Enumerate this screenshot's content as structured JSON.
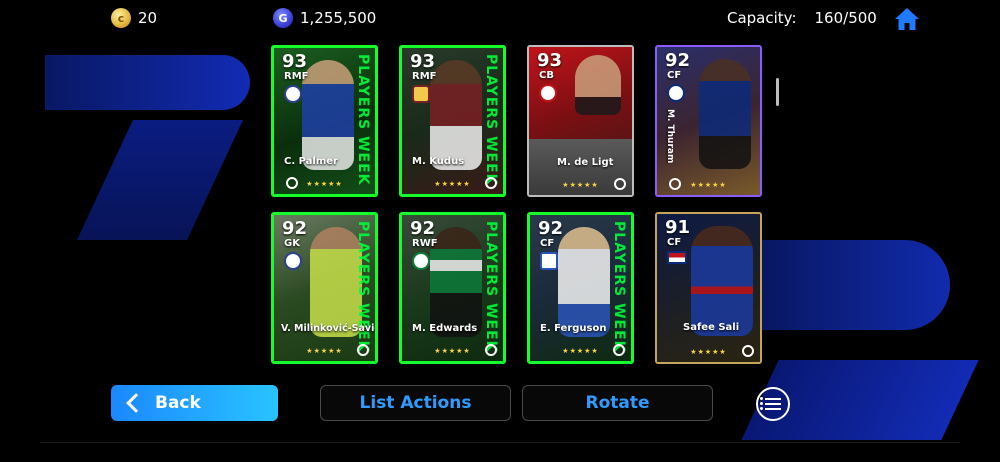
{
  "top_bar": {
    "coins": "20",
    "gp": "1,255,500",
    "capacity_label": "Capacity:",
    "capacity_value": "160/500"
  },
  "icons": {
    "coin": "coin-icon",
    "gp": "gp-icon",
    "home": "home-icon"
  },
  "cards": [
    {
      "rating": "93",
      "position": "RMF",
      "name": "C. Palmer",
      "stars": "★★★★★",
      "banner": "PLAYERS WEEK"
    },
    {
      "rating": "93",
      "position": "RMF",
      "name": "M. Kudus",
      "stars": "★★★★★",
      "banner": "PLAYERS WEEK"
    },
    {
      "rating": "93",
      "position": "CB",
      "name": "M. de Ligt",
      "stars": "★★★★★",
      "banner": ""
    },
    {
      "rating": "92",
      "position": "CF",
      "name": "M. Thuram",
      "stars": "★★★★★",
      "banner": ""
    },
    {
      "rating": "92",
      "position": "GK",
      "name": "V. Milinković-Savić",
      "stars": "★★★★★",
      "banner": "PLAYERS WEEK"
    },
    {
      "rating": "92",
      "position": "RWF",
      "name": "M. Edwards",
      "stars": "★★★★★",
      "banner": "PLAYERS WEEK"
    },
    {
      "rating": "92",
      "position": "CF",
      "name": "E. Ferguson",
      "stars": "★★★★★",
      "banner": "PLAYERS WEEK"
    },
    {
      "rating": "91",
      "position": "CF",
      "name": "Safee Sali",
      "stars": "★★★★★",
      "banner": ""
    }
  ],
  "buttons": {
    "back": "Back",
    "list_actions": "List Actions",
    "rotate": "Rotate"
  },
  "colors": {
    "accent_blue": "#2f9bff",
    "card_green": "#14ff2a",
    "back_gradient_start": "#1b88ff",
    "back_gradient_end": "#29c3ff"
  }
}
